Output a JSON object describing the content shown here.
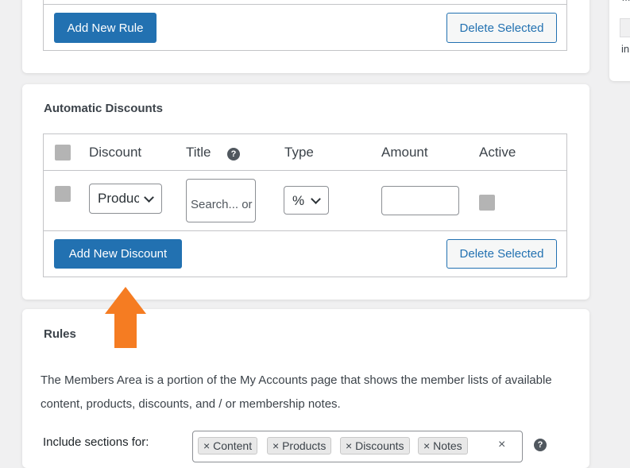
{
  "sidebar_card": {
    "lines": [
      "m",
      "in"
    ]
  },
  "rules_table": {
    "add_button": "Add New Rule",
    "delete_button": "Delete Selected"
  },
  "automatic_discounts": {
    "title": "Automatic Discounts",
    "headers": {
      "discount": "Discount",
      "title": "Title",
      "type": "Type",
      "amount": "Amount",
      "active": "Active"
    },
    "help_icon": "question-circle",
    "row": {
      "discount_select": "Produc",
      "title_placeholder": "Search... or",
      "type_select": "%",
      "amount_value": ""
    },
    "add_button": "Add New Discount",
    "delete_button": "Delete Selected"
  },
  "rules_section": {
    "title": "Rules",
    "description_line1": "The Members Area is a portion of the My Accounts page that shows the member lists of available",
    "description_line2": "content, products, discounts, and / or membership notes.",
    "include_label": "Include sections for:",
    "chips": [
      {
        "remove": "×",
        "label": "Content"
      },
      {
        "remove": "×",
        "label": "Products"
      },
      {
        "remove": "×",
        "label": "Discounts"
      },
      {
        "remove": "×",
        "label": "Notes"
      }
    ],
    "clear": "×"
  },
  "annotation": {
    "arrow_color": "#f57c22"
  },
  "colors": {
    "primary": "#2271b1",
    "background": "#f0f0f1",
    "checkbox": "#b4b4b4"
  }
}
